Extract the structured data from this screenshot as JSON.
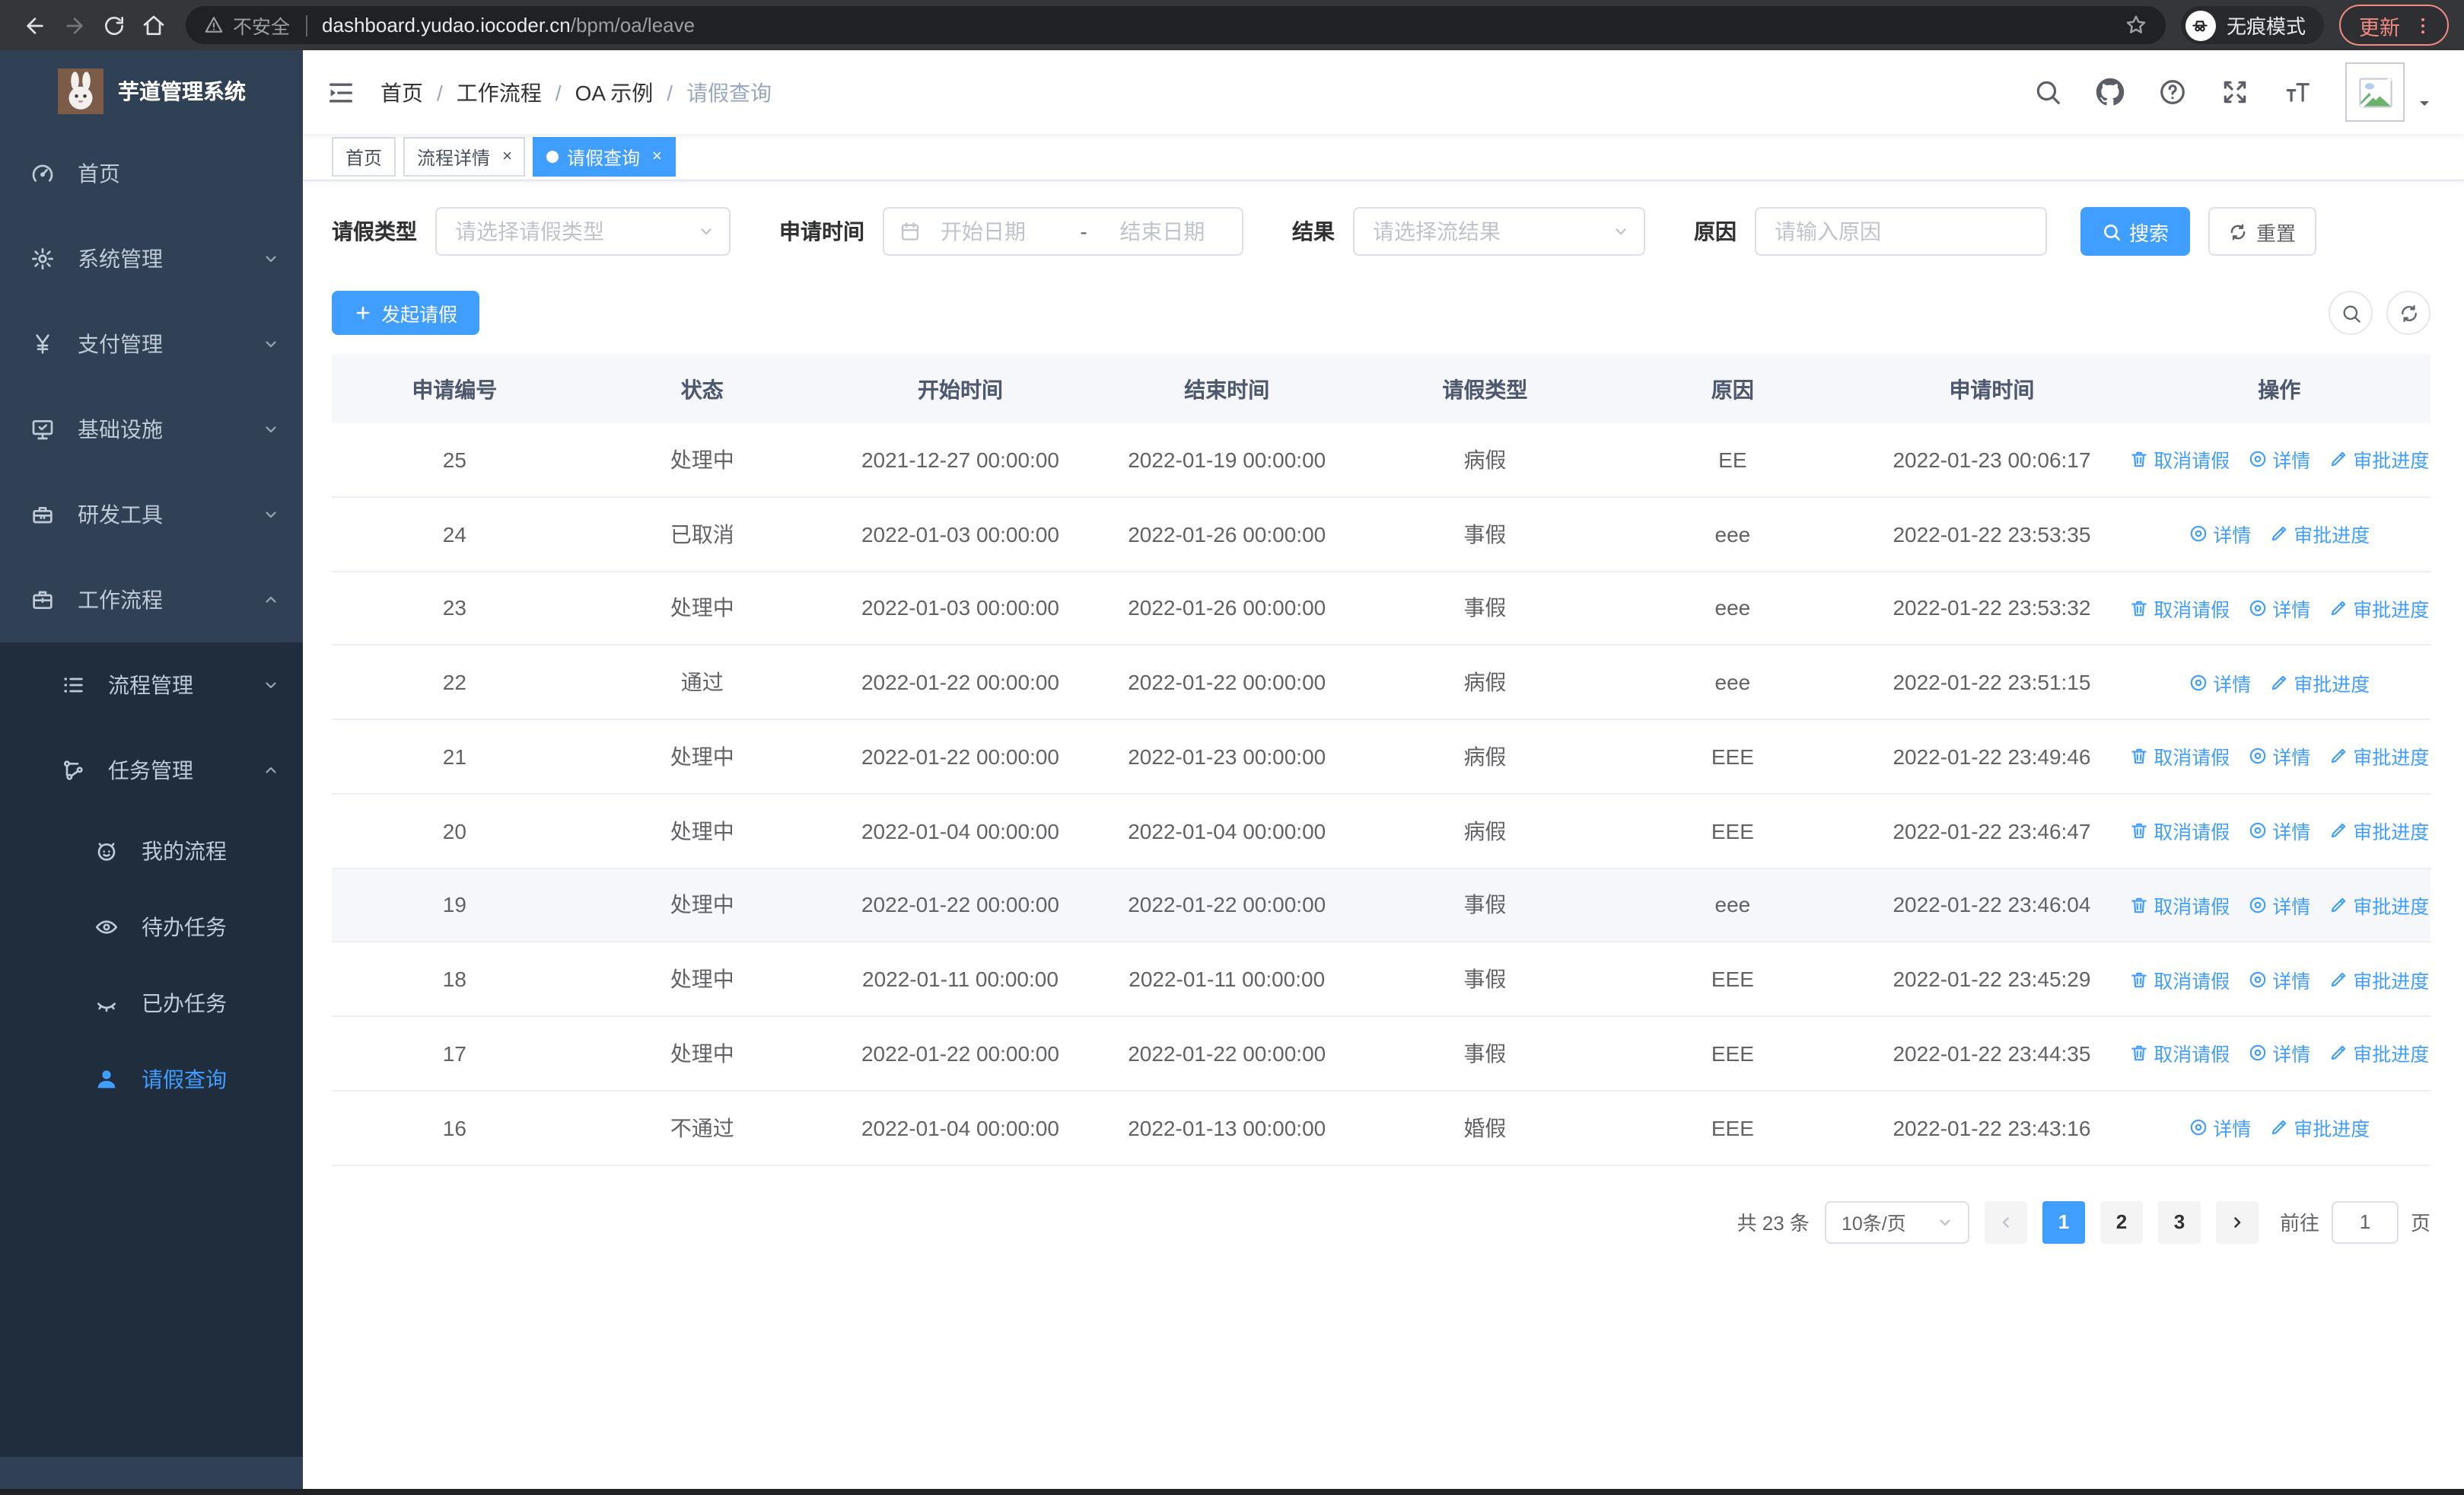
{
  "chrome": {
    "secure_label": "不安全",
    "url_host": "dashboard.yudao.iocoder.cn",
    "url_path": "/bpm/oa/leave",
    "incognito_label": "无痕模式",
    "update_label": "更新"
  },
  "sidebar": {
    "logo_title": "芋道管理系统",
    "items": [
      {
        "key": "home",
        "label": "首页",
        "icon": "dashboard-icon",
        "level": 1,
        "expand": null,
        "sub": false,
        "active": false
      },
      {
        "key": "system",
        "label": "系统管理",
        "icon": "gear-icon",
        "level": 1,
        "expand": "down",
        "sub": false,
        "active": false
      },
      {
        "key": "payment",
        "label": "支付管理",
        "icon": "yen-icon",
        "level": 1,
        "expand": "down",
        "sub": false,
        "active": false
      },
      {
        "key": "infra",
        "label": "基础设施",
        "icon": "monitor-icon",
        "level": 1,
        "expand": "down",
        "sub": false,
        "active": false
      },
      {
        "key": "devtools",
        "label": "研发工具",
        "icon": "toolbox-icon",
        "level": 1,
        "expand": "down",
        "sub": false,
        "active": false
      },
      {
        "key": "workflow",
        "label": "工作流程",
        "icon": "briefcase-icon",
        "level": 1,
        "expand": "up",
        "sub": false,
        "active": false
      },
      {
        "key": "process-mgmt",
        "label": "流程管理",
        "icon": "list-icon",
        "level": 2,
        "expand": "down",
        "sub": true,
        "active": false
      },
      {
        "key": "task-mgmt",
        "label": "任务管理",
        "icon": "flow-icon",
        "level": 2,
        "expand": "up",
        "sub": true,
        "active": false
      },
      {
        "key": "my-process",
        "label": "我的流程",
        "icon": "face-icon",
        "level": 3,
        "expand": null,
        "sub": true,
        "active": false
      },
      {
        "key": "todo-tasks",
        "label": "待办任务",
        "icon": "eye-icon",
        "level": 3,
        "expand": null,
        "sub": true,
        "active": false
      },
      {
        "key": "done-tasks",
        "label": "已办任务",
        "icon": "eye-closed-icon",
        "level": 3,
        "expand": null,
        "sub": true,
        "active": false
      },
      {
        "key": "leave-query",
        "label": "请假查询",
        "icon": "user-icon",
        "level": 3,
        "expand": null,
        "sub": true,
        "active": true
      }
    ]
  },
  "header": {
    "breadcrumb": [
      "首页",
      "工作流程",
      "OA 示例",
      "请假查询"
    ]
  },
  "ui": {
    "breadcrumb_separator": "/",
    "close_glyph": "×"
  },
  "tabs": [
    {
      "label": "首页",
      "closable": false,
      "active": false
    },
    {
      "label": "流程详情",
      "closable": true,
      "active": false
    },
    {
      "label": "请假查询",
      "closable": true,
      "active": true
    }
  ],
  "filters": {
    "type_label": "请假类型",
    "type_placeholder": "请选择请假类型",
    "time_label": "申请时间",
    "time_start_placeholder": "开始日期",
    "time_separator": "-",
    "time_end_placeholder": "结束日期",
    "result_label": "结果",
    "result_placeholder": "请选择流结果",
    "reason_label": "原因",
    "reason_placeholder": "请输入原因",
    "search_label": "搜索",
    "reset_label": "重置"
  },
  "toolbar": {
    "create_label": "发起请假"
  },
  "table": {
    "headers": [
      "申请编号",
      "状态",
      "开始时间",
      "结束时间",
      "请假类型",
      "原因",
      "申请时间",
      "操作"
    ],
    "action_labels": {
      "cancel": "取消请假",
      "detail": "详情",
      "progress": "审批进度"
    },
    "rows": [
      {
        "id": "25",
        "status": "处理中",
        "start": "2021-12-27 00:00:00",
        "end": "2022-01-19 00:00:00",
        "type": "病假",
        "reason": "EE",
        "apply": "2022-01-23 00:06:17",
        "cancel": true,
        "highlight": false
      },
      {
        "id": "24",
        "status": "已取消",
        "start": "2022-01-03 00:00:00",
        "end": "2022-01-26 00:00:00",
        "type": "事假",
        "reason": "eee",
        "apply": "2022-01-22 23:53:35",
        "cancel": false,
        "highlight": false
      },
      {
        "id": "23",
        "status": "处理中",
        "start": "2022-01-03 00:00:00",
        "end": "2022-01-26 00:00:00",
        "type": "事假",
        "reason": "eee",
        "apply": "2022-01-22 23:53:32",
        "cancel": true,
        "highlight": false
      },
      {
        "id": "22",
        "status": "通过",
        "start": "2022-01-22 00:00:00",
        "end": "2022-01-22 00:00:00",
        "type": "病假",
        "reason": "eee",
        "apply": "2022-01-22 23:51:15",
        "cancel": false,
        "highlight": false
      },
      {
        "id": "21",
        "status": "处理中",
        "start": "2022-01-22 00:00:00",
        "end": "2022-01-23 00:00:00",
        "type": "病假",
        "reason": "EEE",
        "apply": "2022-01-22 23:49:46",
        "cancel": true,
        "highlight": false
      },
      {
        "id": "20",
        "status": "处理中",
        "start": "2022-01-04 00:00:00",
        "end": "2022-01-04 00:00:00",
        "type": "病假",
        "reason": "EEE",
        "apply": "2022-01-22 23:46:47",
        "cancel": true,
        "highlight": false
      },
      {
        "id": "19",
        "status": "处理中",
        "start": "2022-01-22 00:00:00",
        "end": "2022-01-22 00:00:00",
        "type": "事假",
        "reason": "eee",
        "apply": "2022-01-22 23:46:04",
        "cancel": true,
        "highlight": true
      },
      {
        "id": "18",
        "status": "处理中",
        "start": "2022-01-11 00:00:00",
        "end": "2022-01-11 00:00:00",
        "type": "事假",
        "reason": "EEE",
        "apply": "2022-01-22 23:45:29",
        "cancel": true,
        "highlight": false
      },
      {
        "id": "17",
        "status": "处理中",
        "start": "2022-01-22 00:00:00",
        "end": "2022-01-22 00:00:00",
        "type": "事假",
        "reason": "EEE",
        "apply": "2022-01-22 23:44:35",
        "cancel": true,
        "highlight": false
      },
      {
        "id": "16",
        "status": "不通过",
        "start": "2022-01-04 00:00:00",
        "end": "2022-01-13 00:00:00",
        "type": "婚假",
        "reason": "EEE",
        "apply": "2022-01-22 23:43:16",
        "cancel": false,
        "highlight": false
      }
    ]
  },
  "pagination": {
    "total_label": "共 23 条",
    "page_size": "10条/页",
    "pages": [
      "1",
      "2",
      "3"
    ],
    "active_page": "1",
    "goto_label": "前往",
    "goto_value": "1",
    "goto_suffix": "页"
  },
  "colors": {
    "primary": "#409EFF",
    "sidebar_bg": "#304156",
    "sidebar_submenu_bg": "#1f2d3d",
    "sidebar_text": "#bfcbd9",
    "update_accent": "#f28b82"
  }
}
